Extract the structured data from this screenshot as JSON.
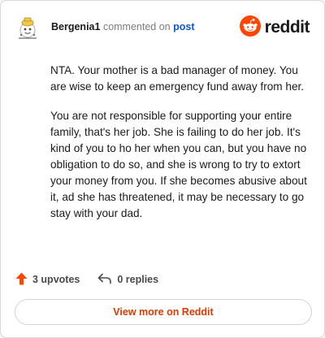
{
  "comment": {
    "author": "Bergenia1",
    "action_text": "commented on",
    "post_link_label": "post",
    "paragraphs": [
      "NTA. Your mother is a bad manager of money. You are wise to keep an emergency fund away from her.",
      "You are not responsible for supporting your entire family, that's her job. She is failing to do her job. It's kind of you to ho her when you can, but you have no obligation to do so, and she is wrong to try to extort your money from you. If she becomes abusive about it, ad she has threatened, it may be necessary to go stay with your dad."
    ],
    "upvotes_label": "3 upvotes",
    "replies_label": "0 replies"
  },
  "brand": {
    "wordmark": "reddit"
  },
  "cta": {
    "view_more_label": "View more on Reddit"
  },
  "icons": {
    "avatar": "snoo-avatar-icon",
    "logo": "reddit-logo-icon",
    "upvote": "upvote-arrow-icon",
    "reply": "reply-arrow-icon"
  },
  "colors": {
    "brand_orange": "#ff4500",
    "link_blue": "#0b57d0",
    "cta_text": "#d93a00",
    "upvote_orange": "#ff4500"
  }
}
